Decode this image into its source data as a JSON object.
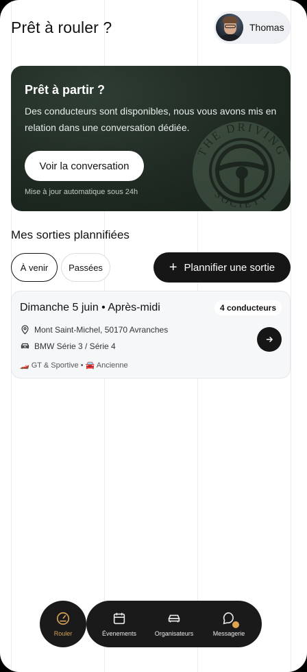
{
  "header": {
    "title": "Prêt à rouler ?",
    "user_name": "Thomas"
  },
  "hero": {
    "title": "Prêt à partir ?",
    "text": "Des conducteurs sont disponibles, nous vous avons mis en relation dans une conversation dédiée.",
    "button_label": "Voir la conversation",
    "note": "Mise à jour automatique sous 24h",
    "seal_text_top": "THE DRIVING",
    "seal_text_bottom": "SOCIETY"
  },
  "section": {
    "title": "Mes sorties plannifiées",
    "filters": [
      "À venir",
      "Passées"
    ],
    "plan_button_label": "Plannifier une sortie"
  },
  "ride": {
    "date": "Dimanche 5 juin • Après-midi",
    "badge": "4 conducteurs",
    "location": "Mont Saint-Michel, 50170 Avranches",
    "car": "BMW Série 3 / Série 4",
    "tags": "🏎️ GT & Sportive • 🚘 Ancienne"
  },
  "nav": {
    "items": [
      {
        "label": "Rouler",
        "icon": "gauge-icon"
      },
      {
        "label": "Évenements",
        "icon": "calendar-icon"
      },
      {
        "label": "Organisateurs",
        "icon": "car-icon"
      },
      {
        "label": "Messagerie",
        "icon": "chat-icon"
      }
    ],
    "active_color": "#d6a35a"
  }
}
